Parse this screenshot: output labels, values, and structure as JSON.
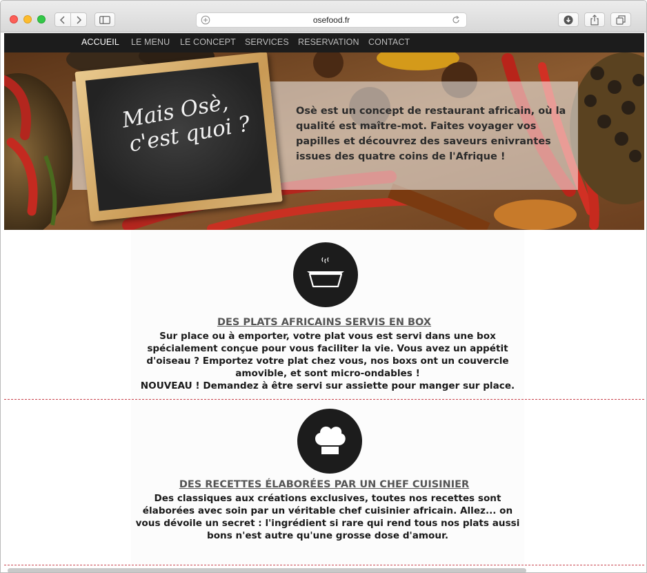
{
  "browser": {
    "url": "osefood.fr"
  },
  "nav": {
    "items": [
      {
        "label": "ACCUEIL",
        "active": true
      },
      {
        "label": "LE MENU",
        "active": false
      },
      {
        "label": "LE CONCEPT",
        "active": false
      },
      {
        "label": "SERVICES",
        "active": false
      },
      {
        "label": "RESERVATION",
        "active": false
      },
      {
        "label": "CONTACT",
        "active": false
      }
    ]
  },
  "hero": {
    "board_line1": "Mais Osè,",
    "board_line2": "c'est quoi ?",
    "description": "Osè est un concept de restaurant africain, où la qualité est maître-mot. Faites voyager vos papilles et découvrez des saveurs enivrantes issues des quatre coins de l'Afrique !"
  },
  "sections": [
    {
      "icon": "food-box-icon",
      "title": "DES PLATS AFRICAINS SERVIS EN BOX",
      "body": "Sur place ou à emporter, votre plat vous est servi dans une box spécialement conçue pour vous faciliter la vie. Vous avez un appétit d'oiseau ? Emportez votre plat chez vous, nos boxs ont un couvercle amovible, et sont micro-ondables !",
      "note": "NOUVEAU ! Demandez à être servi sur assiette pour manger sur place."
    },
    {
      "icon": "chef-hat-icon",
      "title": "DES RECETTES ÉLABORÉES PAR UN CHEF CUISINIER",
      "body": "Des classiques aux créations exclusives, toutes nos recettes sont élaborées avec soin par un véritable chef cuisinier africain. Allez... on vous dévoile un secret : l'ingrédient si rare qui rend tous nos plats aussi bons n'est autre qu'une grosse dose d'amour."
    }
  ],
  "colors": {
    "nav_bg": "#1c1c1c",
    "divider": "#c8404a",
    "icon_circle": "#1c1c1c"
  }
}
